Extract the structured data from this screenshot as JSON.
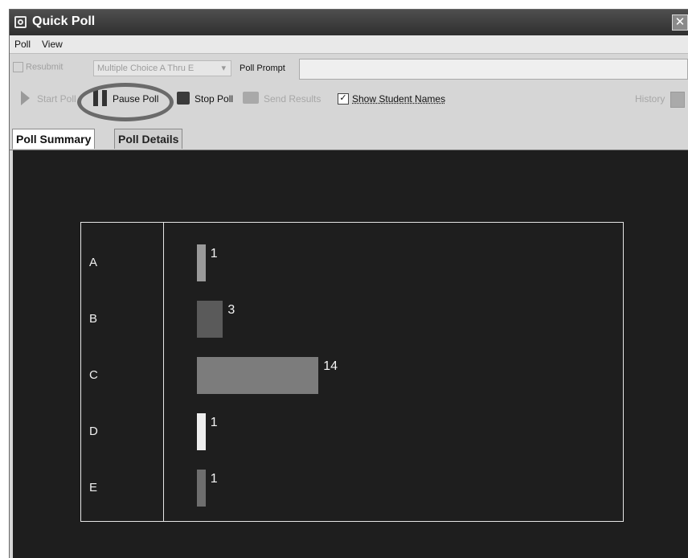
{
  "window": {
    "title": "Quick Poll",
    "close_glyph": "✕"
  },
  "menu": [
    "Poll",
    "View"
  ],
  "row1": {
    "resubmit_label": "Resubmit",
    "question_type": "Multiple Choice A Thru E",
    "prompt_label": "Poll Prompt",
    "prompt_value": ""
  },
  "toolbar": {
    "start_label": "Start Poll",
    "pause_label": "Pause Poll",
    "stop_label": "Stop Poll",
    "send_label": "Send Results",
    "show_names_label": "Show Student Names",
    "show_names_checked": "✓",
    "history_label": "History"
  },
  "tabs": [
    "Poll Summary",
    "Poll Details"
  ],
  "colors": {
    "panel_bg": "#1e1e1e",
    "chart_border": "#e6e6e6"
  },
  "chart_data": {
    "type": "bar",
    "orientation": "horizontal",
    "categories": [
      "A",
      "B",
      "C",
      "D",
      "E"
    ],
    "values": [
      1,
      3,
      14,
      1,
      1
    ],
    "bar_colors": [
      "#9a9a9a",
      "#5a5a5a",
      "#7c7c7c",
      "#eeeeee",
      "#6e6e6e"
    ],
    "title": "",
    "xlabel": "",
    "ylabel": "",
    "grid": false
  }
}
